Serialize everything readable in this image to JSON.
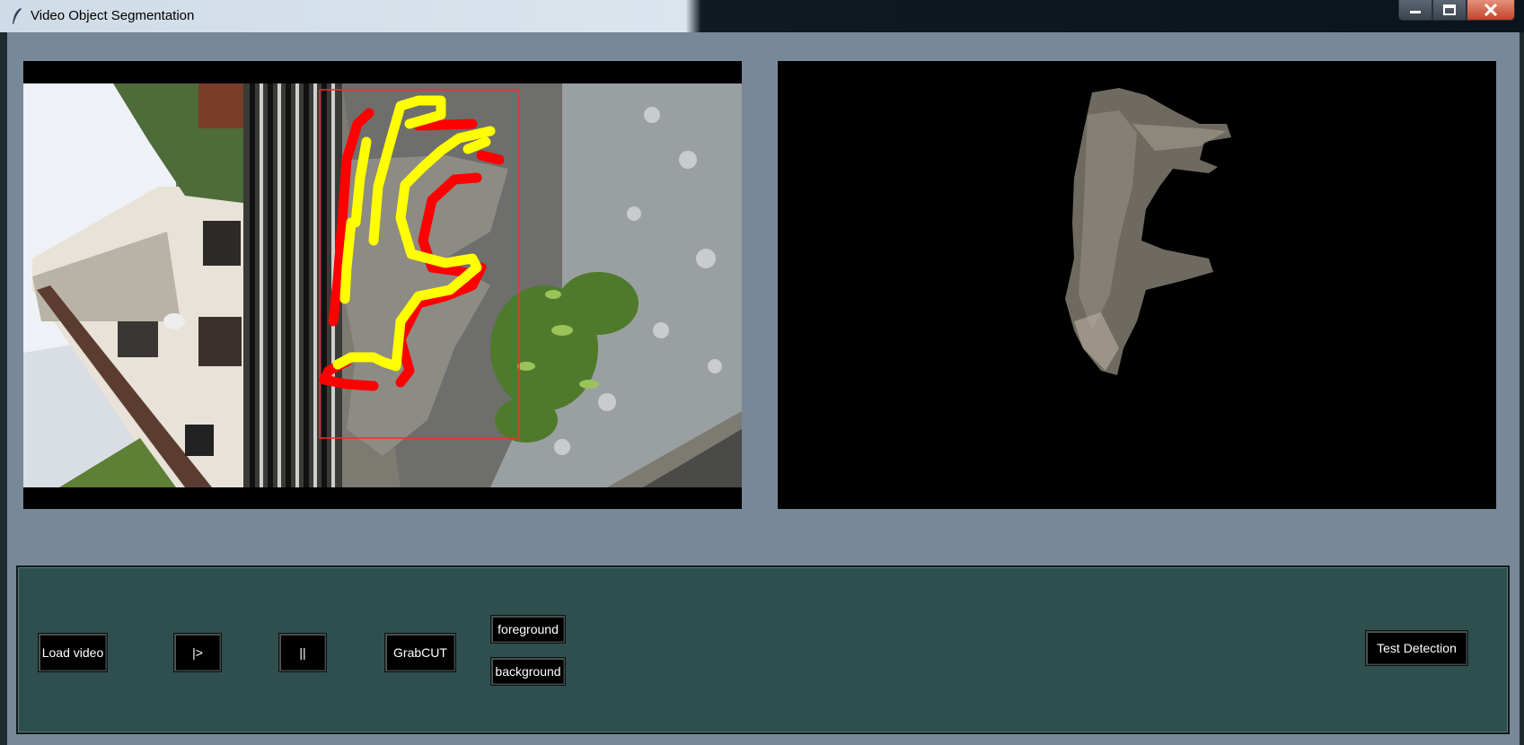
{
  "window": {
    "title": "Video Object Segmentation",
    "controls": [
      "minimize-icon",
      "maximize-icon",
      "close-icon"
    ]
  },
  "views": {
    "input": {
      "content": "rotated video frame of dog with yellow and red scribbles and bounding box"
    },
    "output": {
      "content": "segmented dog on black background"
    }
  },
  "controls": {
    "load_video": "Load video",
    "play": "|>",
    "pause": "||",
    "grabcut": "GrabCUT",
    "foreground": "foreground",
    "background": "background",
    "test_detection": "Test Detection"
  },
  "colors": {
    "frame": "#778898",
    "panel": "#2f4f4f",
    "foreground_scribble": "#ffff00",
    "background_scribble": "#ff0000"
  }
}
